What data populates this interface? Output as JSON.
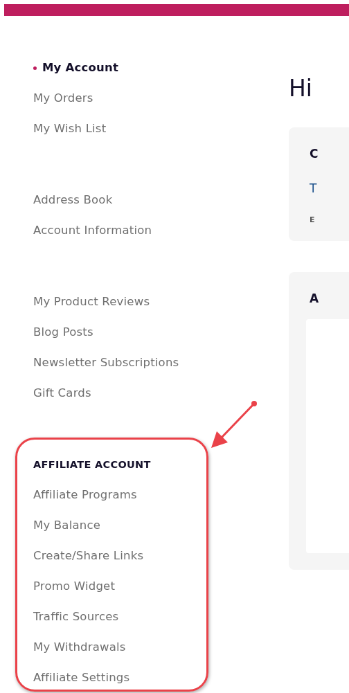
{
  "sidebar": {
    "groups": [
      {
        "items": [
          {
            "label": "My Account",
            "selected": true
          },
          {
            "label": "My Orders",
            "selected": false
          },
          {
            "label": "My Wish List",
            "selected": false
          }
        ]
      },
      {
        "items": [
          {
            "label": "Address Book",
            "selected": false
          },
          {
            "label": "Account Information",
            "selected": false
          }
        ]
      },
      {
        "items": [
          {
            "label": "My Product Reviews",
            "selected": false
          },
          {
            "label": "Blog Posts",
            "selected": false
          },
          {
            "label": "Newsletter Subscriptions",
            "selected": false
          },
          {
            "label": "Gift Cards",
            "selected": false
          }
        ]
      },
      {
        "heading": "AFFILIATE ACCOUNT",
        "items": [
          {
            "label": "Affiliate Programs",
            "selected": false
          },
          {
            "label": "My Balance",
            "selected": false
          },
          {
            "label": "Create/Share Links",
            "selected": false
          },
          {
            "label": "Promo Widget",
            "selected": false
          },
          {
            "label": "Traffic Sources",
            "selected": false
          },
          {
            "label": "My Withdrawals",
            "selected": false
          },
          {
            "label": "Affiliate Settings",
            "selected": false
          }
        ]
      }
    ]
  },
  "main": {
    "greeting": "Hi",
    "cards": [
      {
        "title": "C",
        "lines": [
          {
            "kind": "text",
            "text": "T"
          },
          {
            "kind": "label",
            "text": "E"
          }
        ]
      },
      {
        "title": "A",
        "lines": [
          {
            "kind": "panel"
          }
        ]
      }
    ]
  }
}
